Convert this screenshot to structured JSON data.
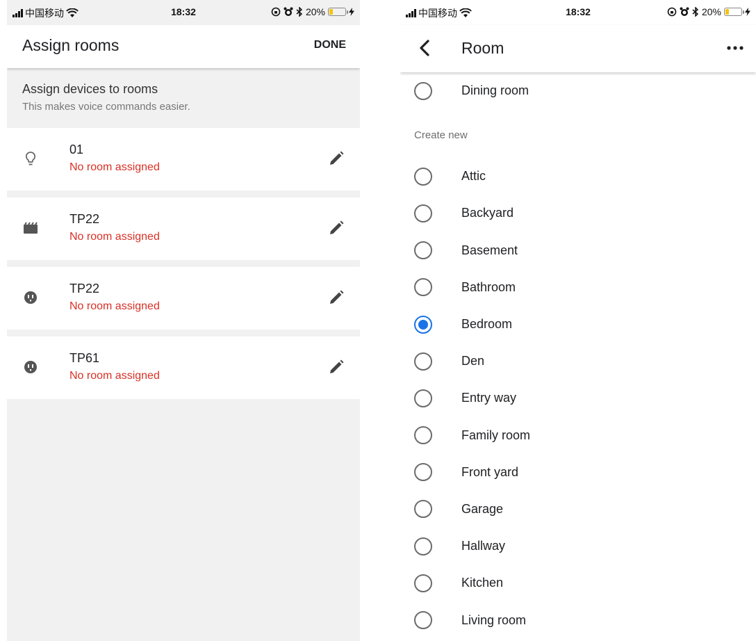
{
  "status_bar": {
    "carrier": "中国移动",
    "time": "18:32",
    "battery_percent": "20%",
    "battery_level": 0.2
  },
  "assign_screen": {
    "title": "Assign rooms",
    "done_label": "DONE",
    "intro_heading": "Assign devices to rooms",
    "intro_subtext": "This makes voice commands easier.",
    "devices": [
      {
        "name": "01",
        "status": "No room assigned",
        "icon": "lightbulb-icon"
      },
      {
        "name": "TP22",
        "status": "No room assigned",
        "icon": "clapperboard-icon"
      },
      {
        "name": "TP22",
        "status": "No room assigned",
        "icon": "outlet-icon"
      },
      {
        "name": "TP61",
        "status": "No room assigned",
        "icon": "outlet-icon"
      }
    ],
    "status_color": "#d93025"
  },
  "room_screen": {
    "title": "Room",
    "existing_rooms": [
      {
        "label": "Dining room",
        "selected": false
      }
    ],
    "section_label": "Create new",
    "new_rooms": [
      {
        "label": "Attic",
        "selected": false
      },
      {
        "label": "Backyard",
        "selected": false
      },
      {
        "label": "Basement",
        "selected": false
      },
      {
        "label": "Bathroom",
        "selected": false
      },
      {
        "label": "Bedroom",
        "selected": true
      },
      {
        "label": "Den",
        "selected": false
      },
      {
        "label": "Entry way",
        "selected": false
      },
      {
        "label": "Family room",
        "selected": false
      },
      {
        "label": "Front yard",
        "selected": false
      },
      {
        "label": "Garage",
        "selected": false
      },
      {
        "label": "Hallway",
        "selected": false
      },
      {
        "label": "Kitchen",
        "selected": false
      },
      {
        "label": "Living room",
        "selected": false
      }
    ],
    "accent_color": "#1a73e8"
  }
}
